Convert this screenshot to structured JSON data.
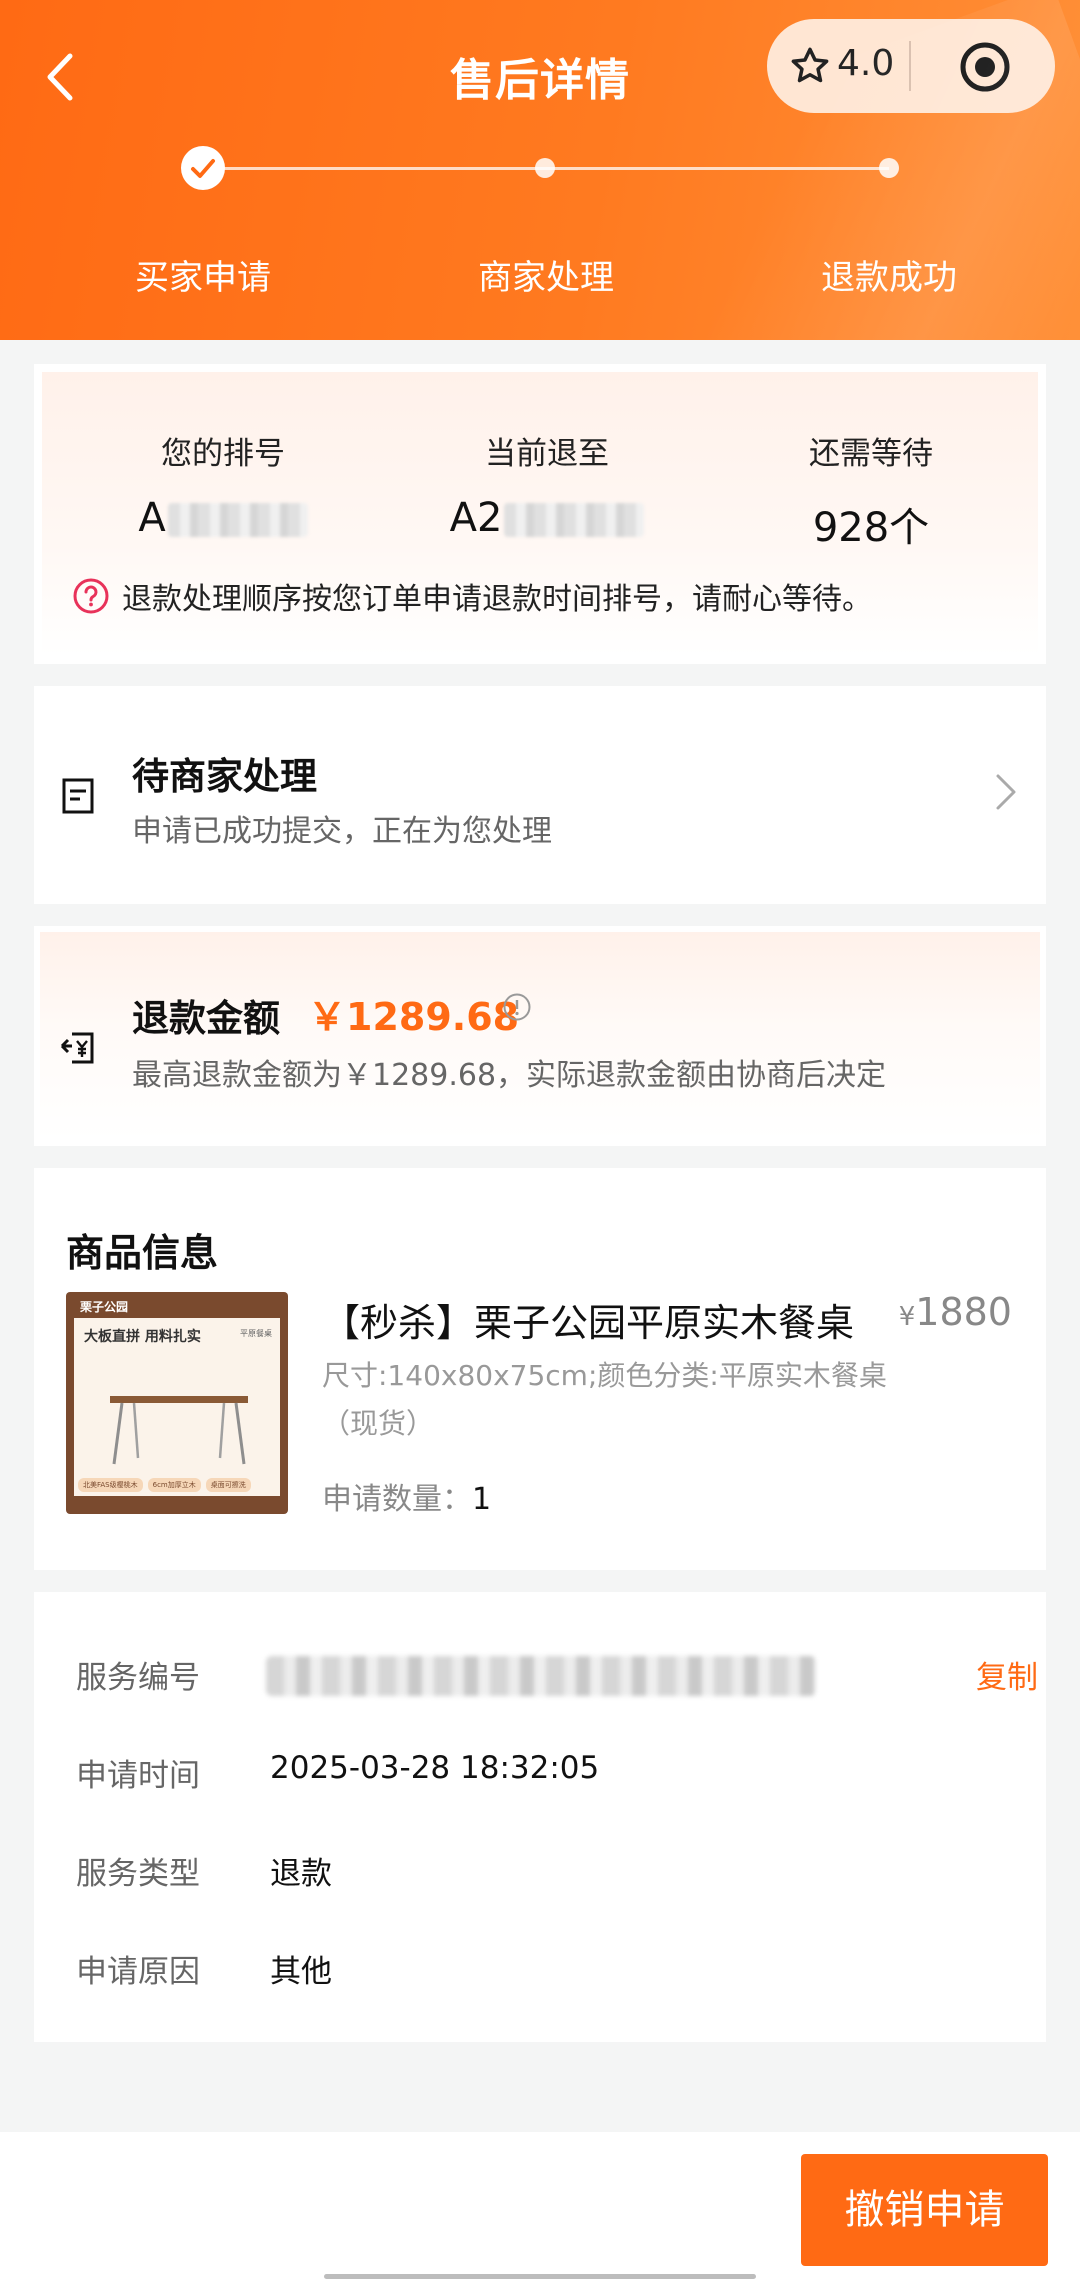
{
  "header": {
    "title": "售后详情",
    "rating": "4.0",
    "steps": [
      "买家申请",
      "商家处理",
      "退款成功"
    ]
  },
  "queue": {
    "my_number_label": "您的排号",
    "my_number_value": "A",
    "current_label": "当前退至",
    "current_value": "A2",
    "wait_label": "还需等待",
    "wait_value": "928个",
    "note": "退款处理顺序按您订单申请退款时间排号，请耐心等待。"
  },
  "status": {
    "title": "待商家处理",
    "subtitle": "申请已成功提交，正在为您处理"
  },
  "refund": {
    "title": "退款金额",
    "amount": "￥1289.68",
    "subtitle": "最高退款金额为￥1289.68，实际退款金额由协商后决定"
  },
  "product": {
    "section_title": "商品信息",
    "name": "【秒杀】栗子公园平原实木餐桌",
    "price_symbol": "¥",
    "price": "1880",
    "spec": "尺寸:140x80x75cm;颜色分类:平原实木餐桌 （现货）",
    "qty_label": "申请数量：",
    "qty_value": "1",
    "image": {
      "brand": "栗子公园",
      "slogan": "大板直拼 用料扎实",
      "mini_label": "平原餐桌",
      "tags": [
        "北美FAS级樱桃木",
        "6cm加厚立木",
        "桌面可擦洗"
      ]
    }
  },
  "service": {
    "copy_label": "复制",
    "rows": [
      {
        "key": "服务编号",
        "value": ""
      },
      {
        "key": "申请时间",
        "value": "2025-03-28 18:32:05"
      },
      {
        "key": "服务类型",
        "value": "退款"
      },
      {
        "key": "申请原因",
        "value": "其他"
      }
    ]
  },
  "bottom": {
    "cancel_label": "撤销申请"
  },
  "colors": {
    "accent": "#ff6a14",
    "header_gradient_start": "#ff6a14",
    "header_gradient_end": "#ff9038"
  }
}
